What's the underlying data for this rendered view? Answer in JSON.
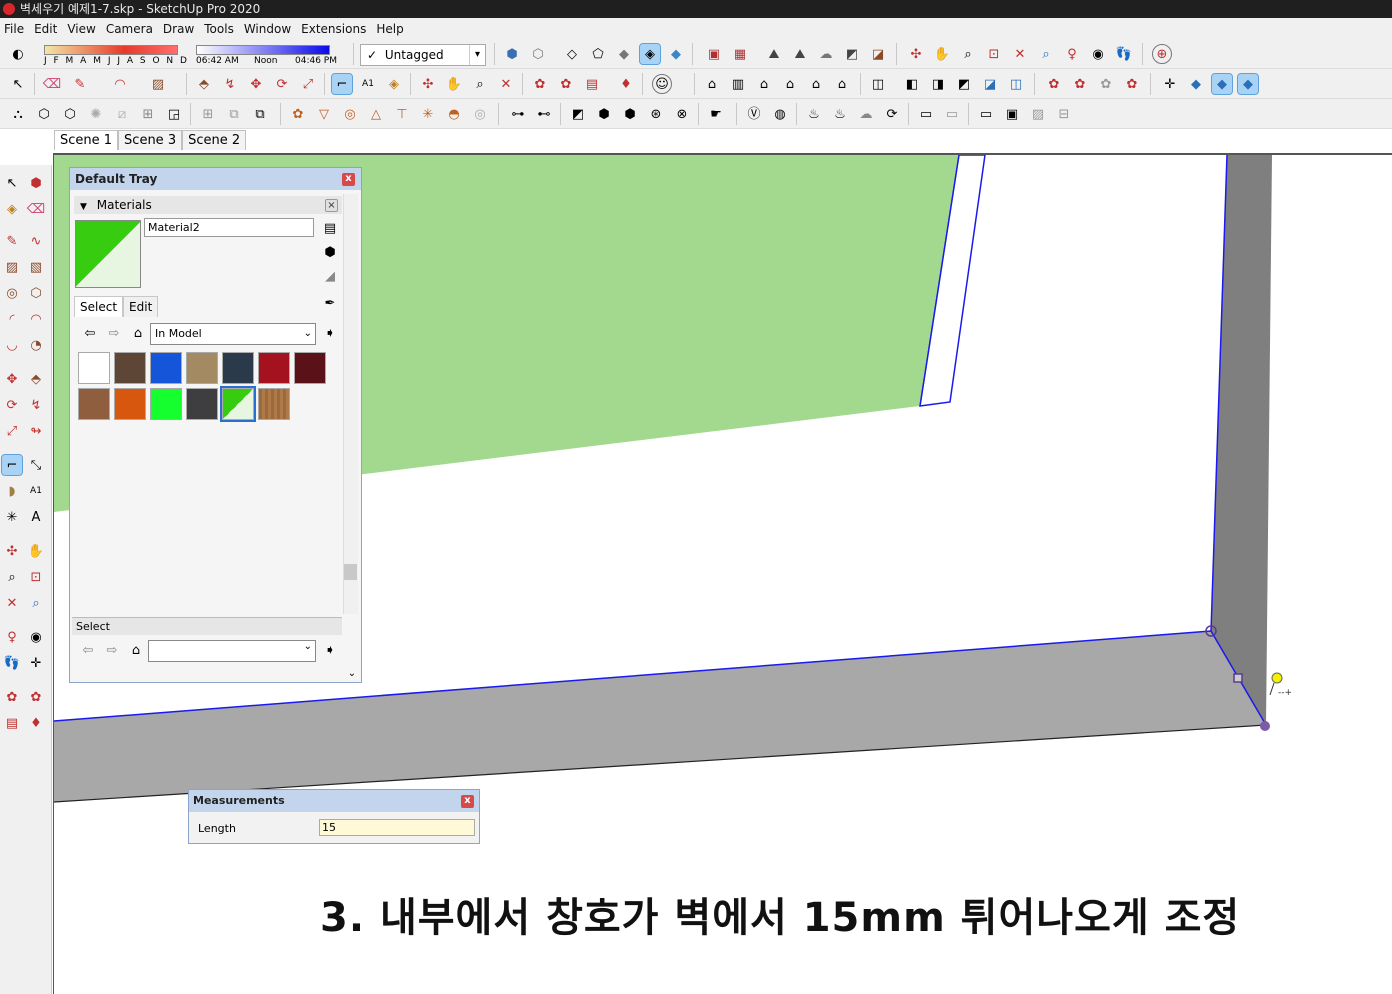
{
  "window": {
    "title": "벽세우기 예제1-7.skp - SketchUp Pro 2020"
  },
  "menu": [
    "File",
    "Edit",
    "View",
    "Camera",
    "Draw",
    "Tools",
    "Window",
    "Extensions",
    "Help"
  ],
  "shadows": {
    "months": "J F M A M J J A S O N D",
    "time_start": "06:42 AM",
    "time_mid": "Noon",
    "time_end": "04:46 PM"
  },
  "tag": {
    "check": "✓",
    "value": "Untagged"
  },
  "scenes": [
    "Scene 1",
    "Scene 3",
    "Scene 2"
  ],
  "tray": {
    "title": "Default Tray",
    "close": "x",
    "materials": {
      "header": "Materials",
      "name": "Material2",
      "tab_select": "Select",
      "tab_edit": "Edit",
      "collection": "In Model",
      "swatches": [
        "#ffffff",
        "#5d4636",
        "#1455d9",
        "#a38a62",
        "#2b3a4b",
        "#a5121f",
        "#5a1218",
        "#8e5e3e",
        "#d7570e",
        "#14ff2d",
        "#3e3e40",
        "#38cc10",
        "#9a6a3e"
      ]
    },
    "select_header": "Select"
  },
  "measurements": {
    "title": "Measurements",
    "label": "Length",
    "value": "15",
    "close": "x"
  },
  "caption": "3. 내부에서 창호가 벽에서 15mm 튀어나오게 조정",
  "colors": {
    "accent": "#1a1aee",
    "glass": "#a3d98f",
    "wall_dark": "#7f7f7f",
    "floor": "#a8a8a8"
  }
}
